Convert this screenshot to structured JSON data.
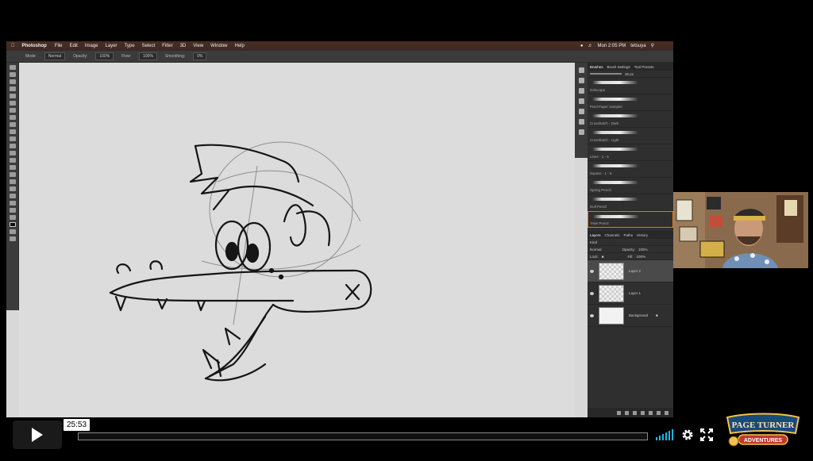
{
  "menubar": {
    "app": "Photoshop",
    "items": [
      "File",
      "Edit",
      "Image",
      "Layer",
      "Type",
      "Select",
      "Filter",
      "3D",
      "View",
      "Window",
      "Help"
    ],
    "clock": "Mon 2:05 PM",
    "user": "tetsuya"
  },
  "options_bar": {
    "mode_label": "Mode:",
    "mode_value": "Normal",
    "opacity_label": "Opacity:",
    "opacity_value": "100%",
    "flow_label": "Flow:",
    "flow_value": "100%",
    "smoothing_label": "Smoothing:",
    "smoothing_value": "0%"
  },
  "brushes_panel": {
    "tabs": [
      "Brushes",
      "Brush Settings",
      "Tool Presets"
    ],
    "size_value": "30 px",
    "items": [
      {
        "name": "Gritscape"
      },
      {
        "name": "Pixel Paper Sampler"
      },
      {
        "name": "Crosshatch - Dark"
      },
      {
        "name": "Crosshatch - Light"
      },
      {
        "name": "Lines - 1 - 6"
      },
      {
        "name": "Square - 1 - 6"
      },
      {
        "name": "Spring Pencil"
      },
      {
        "name": "Dull Pencil"
      },
      {
        "name": "Pale Pencil"
      }
    ]
  },
  "layers_panel": {
    "tabs": [
      "Layers",
      "Channels",
      "Paths",
      "History"
    ],
    "kind": "Kind",
    "blend_mode": "Normal",
    "opacity_label": "Opacity:",
    "opacity_value": "100%",
    "lock_label": "Lock:",
    "fill_label": "Fill:",
    "fill_value": "100%",
    "layers": [
      {
        "name": "Layer 2",
        "selected": true
      },
      {
        "name": "Layer 1",
        "selected": false
      },
      {
        "name": "Background",
        "selected": false
      }
    ]
  },
  "player": {
    "time": "25:53",
    "progress": 0.0,
    "accent": "#19b7ea"
  },
  "logo": {
    "line1": "PAGE TURNER",
    "line2": "ADVENTURES"
  }
}
